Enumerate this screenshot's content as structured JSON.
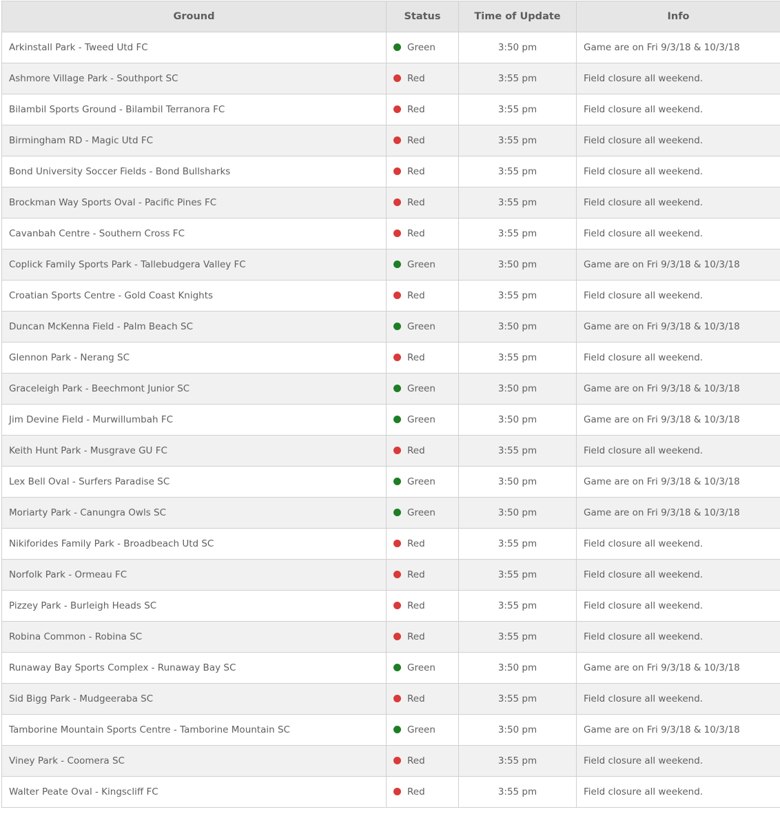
{
  "table": {
    "headers": [
      "Ground",
      "Status",
      "Time of Update",
      "Info"
    ],
    "status_colors": {
      "Green": "#1e7e24",
      "Red": "#d93a3a"
    },
    "rows": [
      {
        "ground": "Arkinstall Park - Tweed Utd FC",
        "status": "Green",
        "time": "3:50 pm",
        "info": "Game are on Fri 9/3/18 & 10/3/18"
      },
      {
        "ground": "Ashmore Village Park - Southport SC",
        "status": "Red",
        "time": "3:55 pm",
        "info": "Field closure all weekend."
      },
      {
        "ground": "Bilambil Sports Ground - Bilambil Terranora FC",
        "status": "Red",
        "time": "3:55 pm",
        "info": "Field closure all weekend."
      },
      {
        "ground": "Birmingham RD - Magic Utd FC",
        "status": "Red",
        "time": "3:55 pm",
        "info": "Field closure all weekend."
      },
      {
        "ground": "Bond University Soccer Fields - Bond Bullsharks",
        "status": "Red",
        "time": "3:55 pm",
        "info": "Field closure all weekend."
      },
      {
        "ground": "Brockman Way Sports Oval - Pacific Pines FC",
        "status": "Red",
        "time": "3:55 pm",
        "info": "Field closure all weekend."
      },
      {
        "ground": "Cavanbah Centre - Southern Cross FC",
        "status": "Red",
        "time": "3:55 pm",
        "info": "Field closure all weekend."
      },
      {
        "ground": "Coplick Family Sports Park - Tallebudgera Valley FC",
        "status": "Green",
        "time": "3:50 pm",
        "info": "Game are on Fri 9/3/18 & 10/3/18"
      },
      {
        "ground": "Croatian Sports Centre - Gold Coast Knights",
        "status": "Red",
        "time": "3:55 pm",
        "info": "Field closure all weekend."
      },
      {
        "ground": "Duncan McKenna Field - Palm Beach SC",
        "status": "Green",
        "time": "3:50 pm",
        "info": "Game are on Fri 9/3/18 & 10/3/18"
      },
      {
        "ground": "Glennon Park - Nerang SC",
        "status": "Red",
        "time": "3:55 pm",
        "info": "Field closure all weekend."
      },
      {
        "ground": "Graceleigh Park - Beechmont Junior SC",
        "status": "Green",
        "time": "3:50 pm",
        "info": "Game are on Fri 9/3/18 & 10/3/18"
      },
      {
        "ground": "Jim Devine Field - Murwillumbah FC",
        "status": "Green",
        "time": "3:50 pm",
        "info": "Game are on Fri 9/3/18 & 10/3/18"
      },
      {
        "ground": "Keith Hunt Park - Musgrave GU FC",
        "status": "Red",
        "time": "3:55 pm",
        "info": "Field closure all weekend."
      },
      {
        "ground": "Lex Bell Oval - Surfers Paradise SC",
        "status": "Green",
        "time": "3:50 pm",
        "info": "Game are on Fri 9/3/18 & 10/3/18"
      },
      {
        "ground": "Moriarty Park - Canungra Owls SC",
        "status": "Green",
        "time": "3:50 pm",
        "info": "Game are on Fri 9/3/18 & 10/3/18"
      },
      {
        "ground": "Nikiforides Family Park - Broadbeach Utd SC",
        "status": "Red",
        "time": "3:55 pm",
        "info": "Field closure all weekend."
      },
      {
        "ground": "Norfolk Park - Ormeau FC",
        "status": "Red",
        "time": "3:55 pm",
        "info": "Field closure all weekend."
      },
      {
        "ground": "Pizzey Park - Burleigh Heads SC",
        "status": "Red",
        "time": "3:55 pm",
        "info": "Field closure all weekend."
      },
      {
        "ground": "Robina Common - Robina SC",
        "status": "Red",
        "time": "3:55 pm",
        "info": "Field closure all weekend."
      },
      {
        "ground": "Runaway Bay Sports Complex - Runaway Bay SC",
        "status": "Green",
        "time": "3:50 pm",
        "info": "Game are on Fri 9/3/18 & 10/3/18"
      },
      {
        "ground": "Sid Bigg Park - Mudgeeraba SC",
        "status": "Red",
        "time": "3:55 pm",
        "info": "Field closure all weekend."
      },
      {
        "ground": "Tamborine Mountain Sports Centre - Tamborine Mountain SC",
        "status": "Green",
        "time": "3:50 pm",
        "info": "Game are on Fri 9/3/18 & 10/3/18"
      },
      {
        "ground": "Viney Park - Coomera SC",
        "status": "Red",
        "time": "3:55 pm",
        "info": "Field closure all weekend."
      },
      {
        "ground": "Walter Peate Oval - Kingscliff FC",
        "status": "Red",
        "time": "3:55 pm",
        "info": "Field closure all weekend."
      }
    ]
  }
}
